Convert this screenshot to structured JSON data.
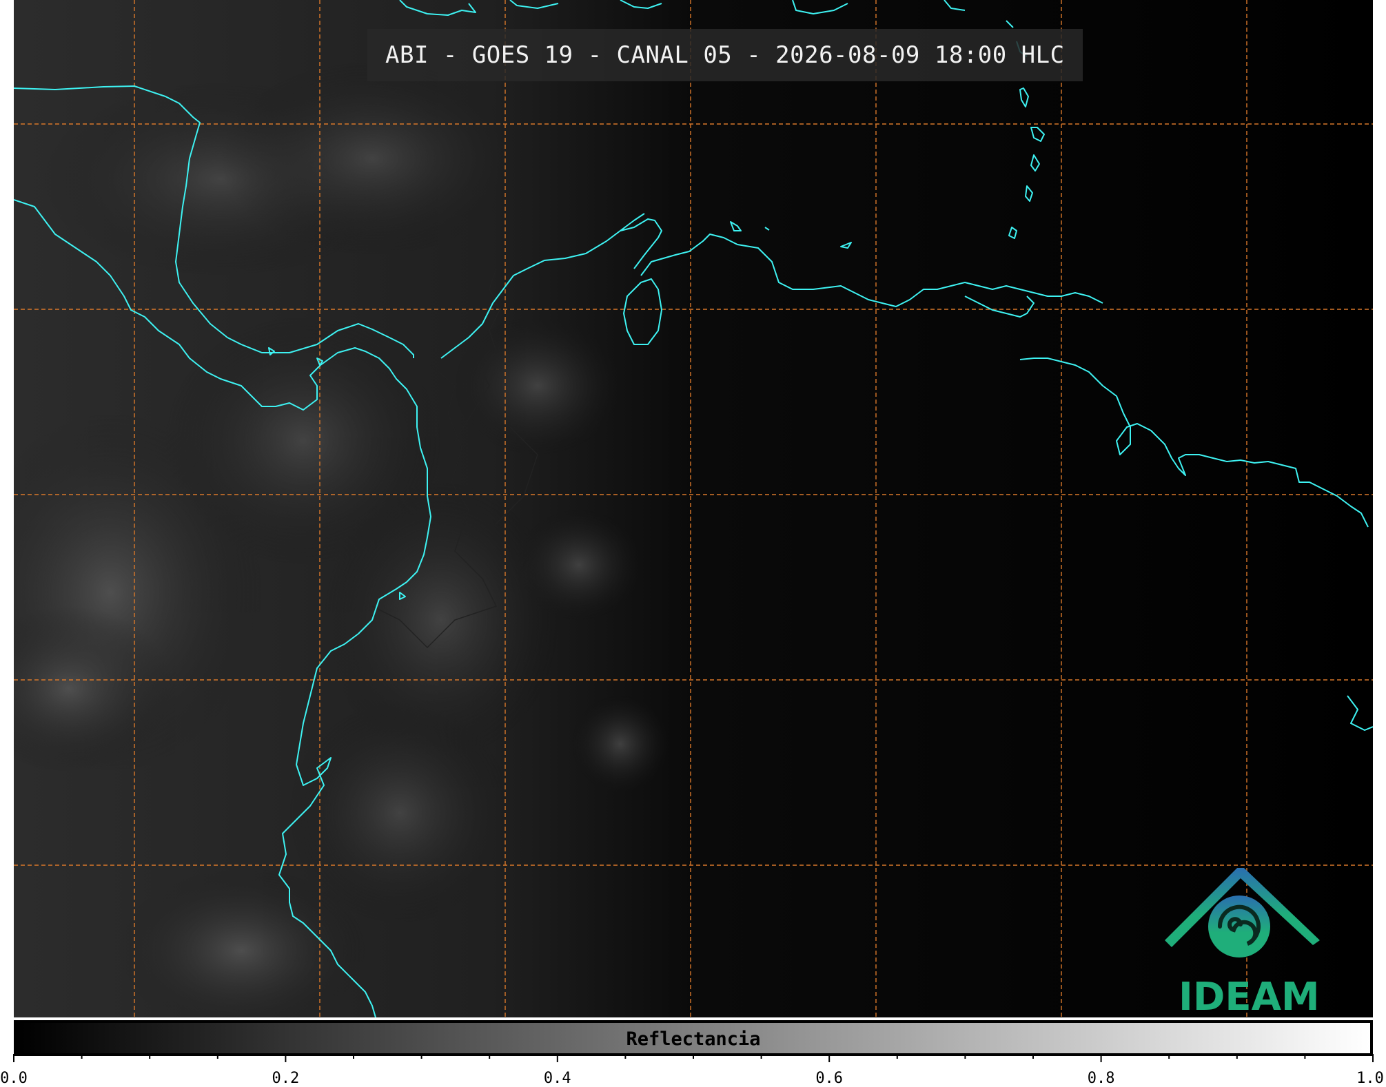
{
  "title": "ABI - GOES 19 - CANAL 05 - 2026-08-09 18:00 HLC",
  "logo": {
    "text": "IDEAM",
    "color_teal": "#1fae7a",
    "color_blue": "#2a7fa8"
  },
  "colorbar": {
    "label": "Reflectancia",
    "range": [
      0.0,
      1.0
    ],
    "ticks": [
      "0.0",
      "0.2",
      "0.4",
      "0.6",
      "0.8",
      "1.0"
    ],
    "colormap": "gray"
  },
  "map": {
    "background": "#000000",
    "coastline_color": "#3ef2f2",
    "grid_color": "#d9782a",
    "border_color": "#222222",
    "grid_style": "dashed"
  }
}
